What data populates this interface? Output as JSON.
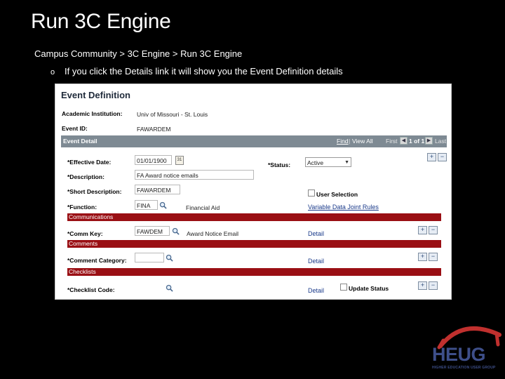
{
  "slide": {
    "title": "Run 3C Engine",
    "breadcrumb": "Campus Community > 3C Engine > Run 3C Engine",
    "bullet_marker": "o",
    "bullet_text": "If you click the Details link it will show you the Event Definition details"
  },
  "event_definition": {
    "title": "Event Definition",
    "academic_institution_label": "Academic Institution:",
    "academic_institution_value": "Univ of Missouri - St. Louis",
    "event_id_label": "Event ID:",
    "event_id_value": "FAWARDEM"
  },
  "event_detail": {
    "bar_title": "Event Detail",
    "find_link": "Find",
    "view_all": "View All",
    "first": "First",
    "range": "1 of 1",
    "last": "Last",
    "effective_date_label": "*Effective Date:",
    "effective_date_value": "01/01/1900",
    "status_label": "*Status:",
    "status_value": "Active",
    "description_label": "*Description:",
    "description_value": "FA Award notice emails",
    "short_description_label": "*Short Description:",
    "short_description_value": "FAWARDEM",
    "user_selection_label": "User Selection",
    "function_label": "*Function:",
    "function_value": "FINA",
    "function_desc": "Financial Aid",
    "variable_data_link": "Variable Data Joint Rules"
  },
  "communications": {
    "bar_title": "Communications",
    "comm_key_label": "*Comm Key:",
    "comm_key_value": "FAWDEM",
    "comm_key_desc": "Award Notice Email",
    "detail_link": "Detail"
  },
  "comments": {
    "bar_title": "Comments",
    "category_label": "*Comment Category:",
    "category_value": "",
    "detail_link": "Detail"
  },
  "checklists": {
    "bar_title": "Checklists",
    "code_label": "*Checklist Code:",
    "code_value": "",
    "detail_link": "Detail",
    "update_status_label": "Update Status"
  },
  "logo": {
    "text": "HEUG",
    "subtitle": "HIGHER EDUCATION USER GROUP",
    "colors": {
      "navy": "#3e4f8a",
      "red": "#c0302e"
    }
  },
  "colors": {
    "section_bar": "#9a0f14",
    "event_bar": "#7e8a93",
    "background": "#000000"
  }
}
